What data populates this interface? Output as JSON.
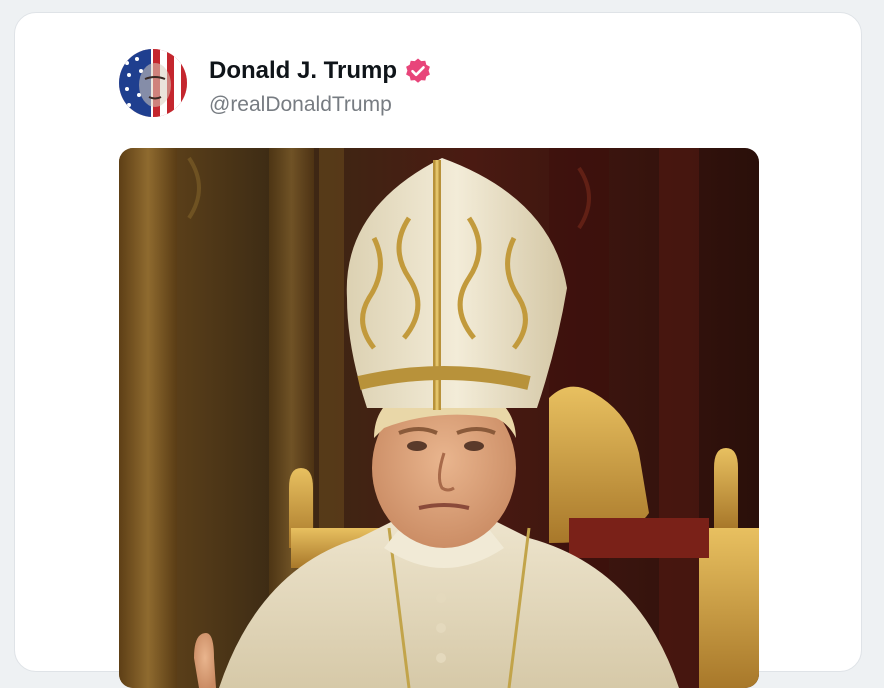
{
  "post": {
    "author": {
      "display_name": "Donald J. Trump",
      "handle": "@realDonaldTrump",
      "verified": true,
      "verified_badge_color": "#e8457a",
      "avatar_icon": "american-flag-portrait-avatar"
    },
    "media": {
      "kind": "image",
      "subject": "pope-portrait-image"
    }
  },
  "colors": {
    "card_background": "#ffffff",
    "page_background": "#eef1f3",
    "name_text": "#0f1419",
    "handle_text": "#777c82"
  }
}
